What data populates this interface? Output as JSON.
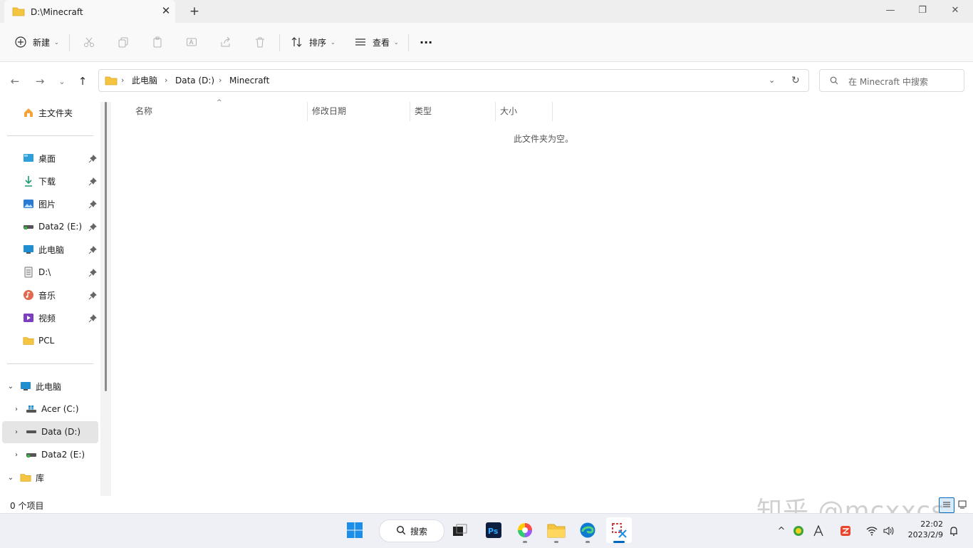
{
  "window": {
    "tab_title": "D:\\Minecraft",
    "new_tab_symbol": "+",
    "close_tab_symbol": "✕",
    "minimize_symbol": "—",
    "maximize_symbol": "❐",
    "close_symbol": "✕"
  },
  "toolbar": {
    "new_label": "新建",
    "sort_label": "排序",
    "view_label": "查看",
    "more_symbol": "···"
  },
  "address": {
    "crumbs": [
      "此电脑",
      "Data (D:)",
      "Minecraft"
    ],
    "search_placeholder": "在 Minecraft 中搜索"
  },
  "sidebar": {
    "home": "主文件夹",
    "pinned": [
      {
        "label": "桌面",
        "icon": "desktop-icon"
      },
      {
        "label": "下载",
        "icon": "download-icon"
      },
      {
        "label": "图片",
        "icon": "pictures-icon"
      },
      {
        "label": "Data2 (E:)",
        "icon": "drive-icon"
      },
      {
        "label": "此电脑",
        "icon": "pc-icon"
      },
      {
        "label": "D:\\",
        "icon": "document-icon"
      },
      {
        "label": "音乐",
        "icon": "music-icon"
      },
      {
        "label": "视频",
        "icon": "video-icon"
      },
      {
        "label": "PCL",
        "icon": "folder-icon"
      }
    ],
    "tree": [
      {
        "label": "此电脑",
        "icon": "pc-icon"
      },
      {
        "label": "Acer (C:)",
        "icon": "windows-drive-icon"
      },
      {
        "label": "Data (D:)",
        "icon": "drive-icon"
      },
      {
        "label": "Data2 (E:)",
        "icon": "drive-icon"
      },
      {
        "label": "库",
        "icon": "folder-icon"
      }
    ]
  },
  "content": {
    "columns": [
      "名称",
      "修改日期",
      "类型",
      "大小"
    ],
    "empty_message": "此文件夹为空。"
  },
  "status_bar": {
    "item_count": "0 个项目"
  },
  "taskbar": {
    "search_label": "搜索",
    "time": "22:02",
    "date": "2023/2/9"
  },
  "watermark": "知乎 @mcxxcs",
  "colors": {
    "accent": "#0067c0",
    "folder": "#f5c542",
    "selected_bg": "#e5e5e5"
  }
}
